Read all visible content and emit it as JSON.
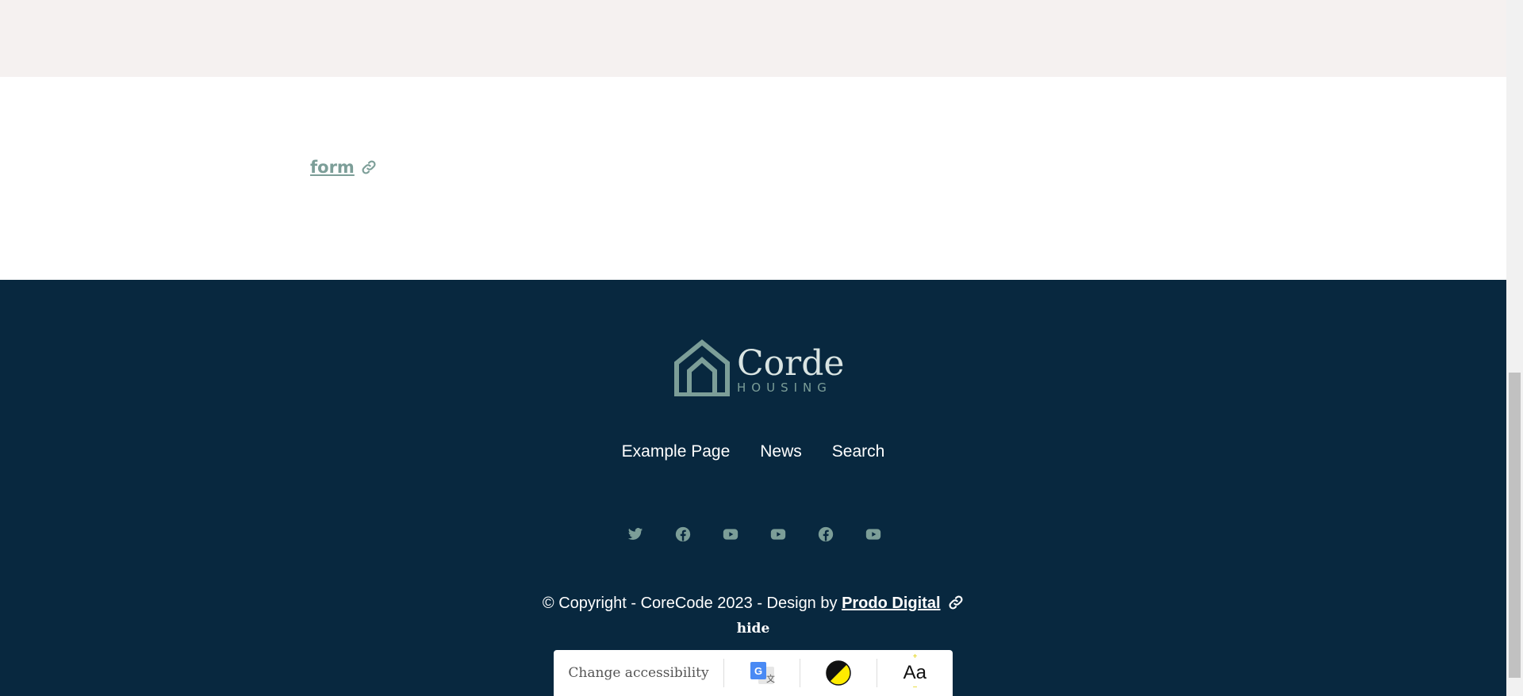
{
  "content": {
    "form_link": "form"
  },
  "footer": {
    "logo": {
      "title": "Corde",
      "subtitle": "HOUSING"
    },
    "nav": [
      {
        "label": "Example Page"
      },
      {
        "label": "News"
      },
      {
        "label": "Search"
      }
    ],
    "socials": [
      "twitter-icon",
      "facebook-icon",
      "youtube-icon",
      "youtube-icon",
      "facebook-icon",
      "youtube-icon"
    ],
    "copyright": {
      "text": "© Copyright - CoreCode 2023 - Design by",
      "designer": "Prodo Digital"
    },
    "hide_label": "hide"
  },
  "accessibility_bar": {
    "change_label": "Change accessibility",
    "icons": [
      "google-translate-icon",
      "contrast-icon",
      "text-size-icon"
    ]
  },
  "colors": {
    "accent": "#7c9e98",
    "footer_bg": "#08283f",
    "top_band": "#f5f1f0"
  }
}
